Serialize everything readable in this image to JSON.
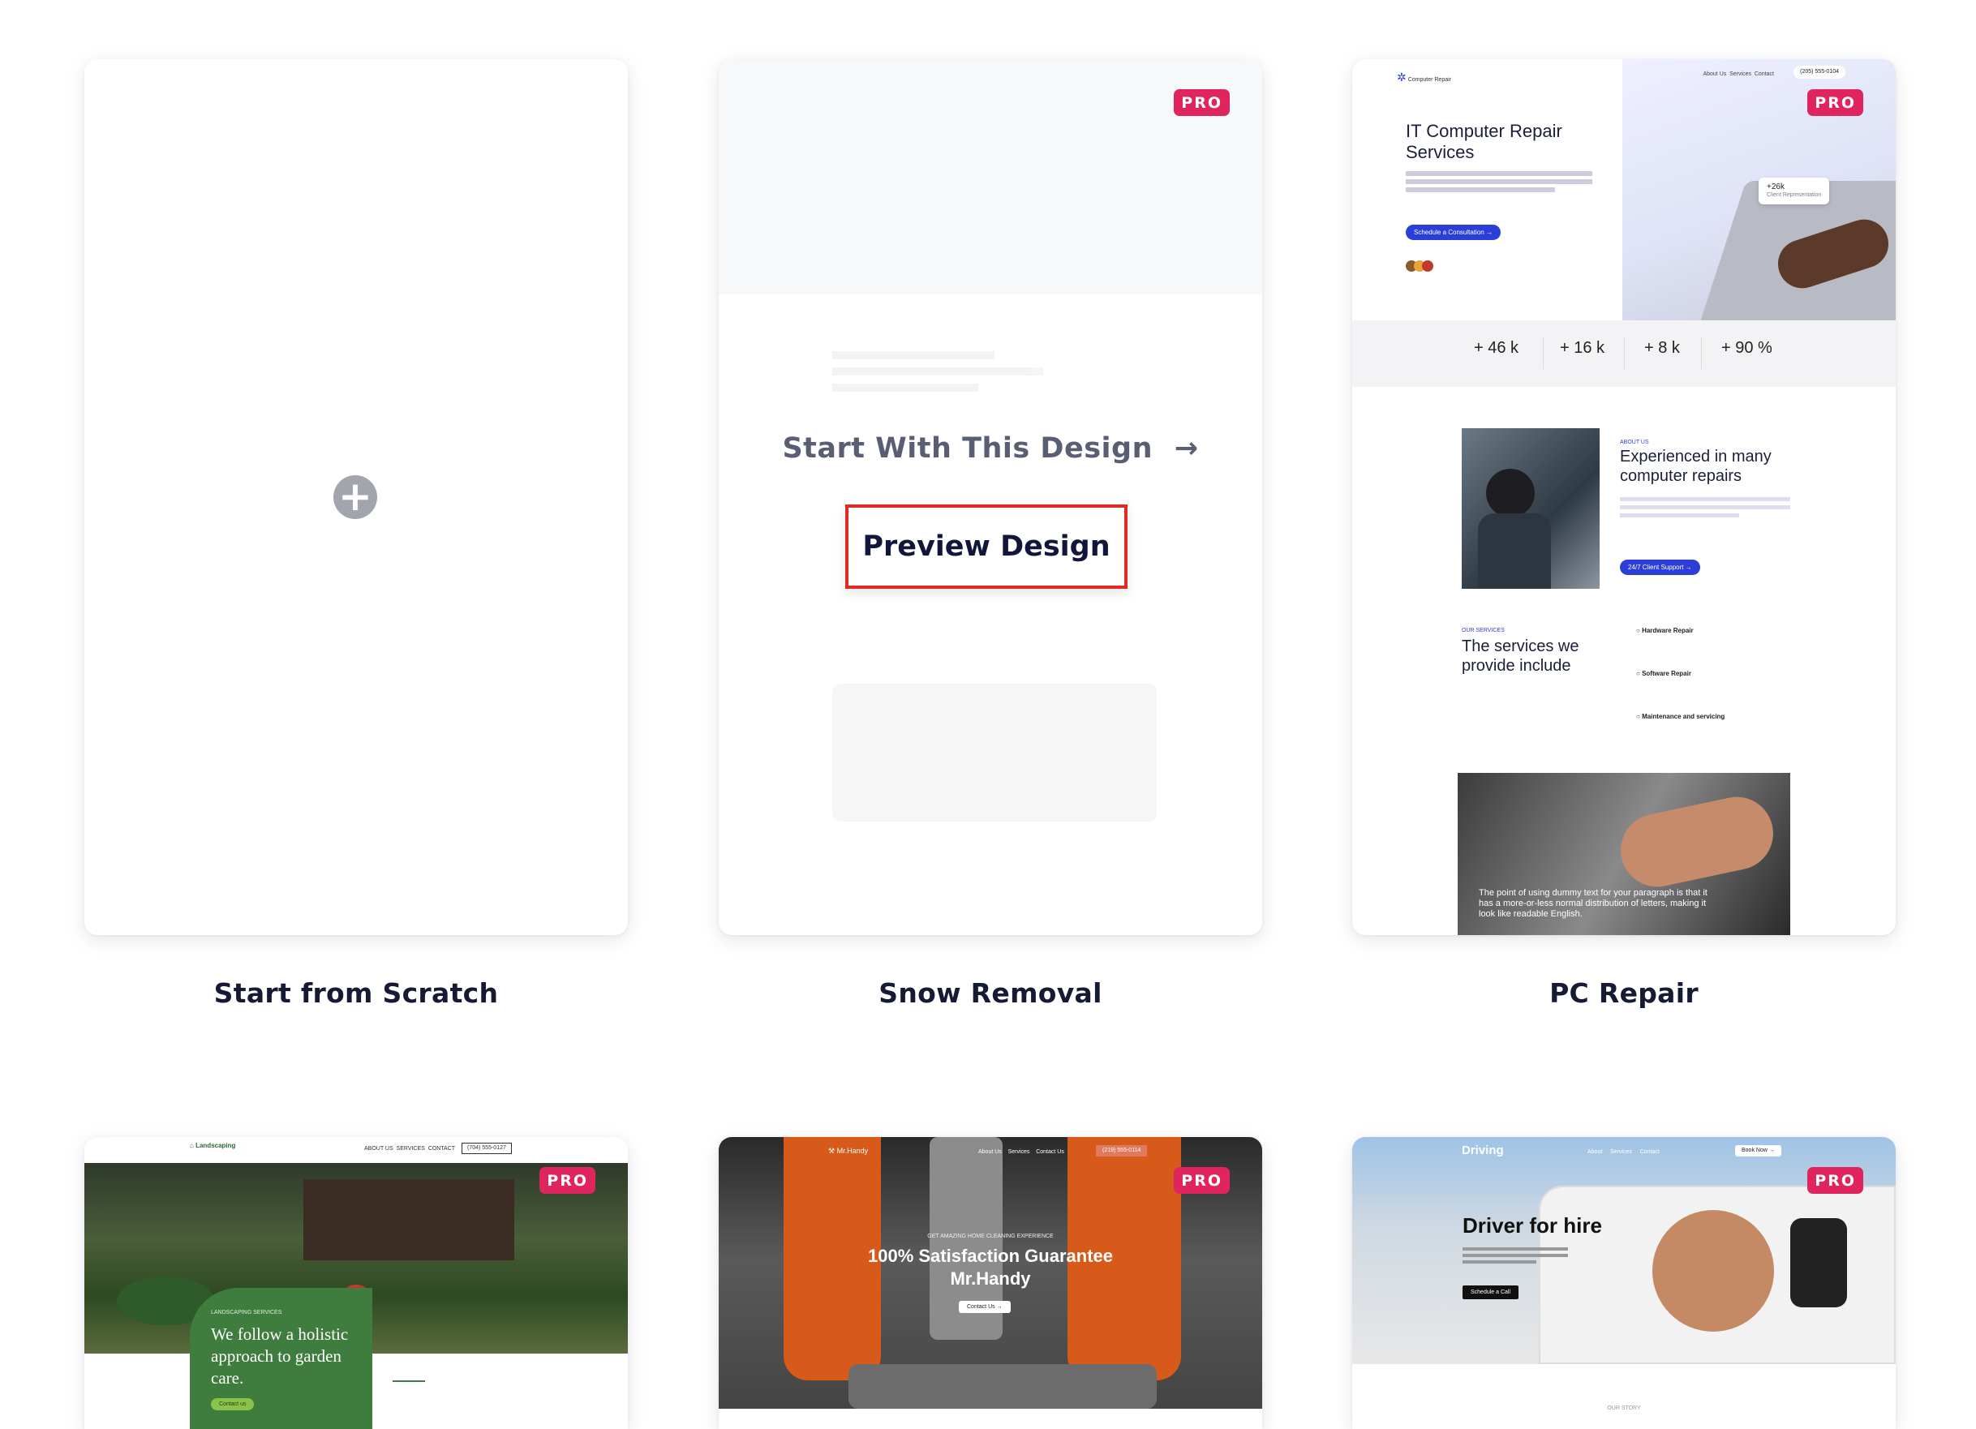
{
  "badges": {
    "pro": "PRO"
  },
  "cards": [
    {
      "label": "Start from Scratch"
    },
    {
      "label": "Snow Removal",
      "overlay": {
        "start_label": "Start With This Design",
        "preview_label": "Preview Design"
      }
    },
    {
      "label": "PC Repair"
    }
  ],
  "pc_repair": {
    "brand": "Computer Repair",
    "nav": [
      "About Us",
      "Services",
      "Contact"
    ],
    "phone": "(205) 555-0104",
    "hero_title": "IT Computer Repair Services",
    "hero_button": "Schedule a Consultation →",
    "badge_value": "+26k",
    "badge_caption": "Client Representation",
    "stats": [
      "+ 46 k",
      "+ 16 k",
      "+ 8 k",
      "+ 90 %"
    ],
    "about_kicker": "ABOUT US",
    "about_title": "Experienced in many computer repairs",
    "about_button": "24/7 Client Support →",
    "services_kicker": "OUR SERVICES",
    "services_title": "The services we provide include",
    "services": [
      "Hardware Repair",
      "Software Repair",
      "Maintenance and servicing"
    ],
    "quote": "The point of using dummy text for your paragraph is that it has a more-or-less normal distribution of letters, making it look like readable English."
  },
  "landscaping": {
    "brand": "Landscaping",
    "nav": [
      "ABOUT US",
      "SERVICES",
      "CONTACT"
    ],
    "phone": "(704) 555-0127",
    "kicker": "LANDSCAPING SERVICES",
    "headline": "We follow a holistic approach to garden care.",
    "button": "Contact us"
  },
  "mrhandy": {
    "brand": "Mr.Handy",
    "nav": [
      "About Us",
      "Services",
      "Contact Us"
    ],
    "phone": "(219) 555-0114",
    "kicker": "GET AMAZING HOME CLEANING EXPERIENCE",
    "headline1": "100% Satisfaction Guarantee",
    "headline2": "Mr.Handy",
    "button": "Contact Us →"
  },
  "driving": {
    "brand": "Driving",
    "nav": [
      "About",
      "Services",
      "Contact"
    ],
    "book": "Book Now →",
    "headline": "Driver for hire",
    "button": "Schedule a Call",
    "kicker": "OUR STORY"
  }
}
